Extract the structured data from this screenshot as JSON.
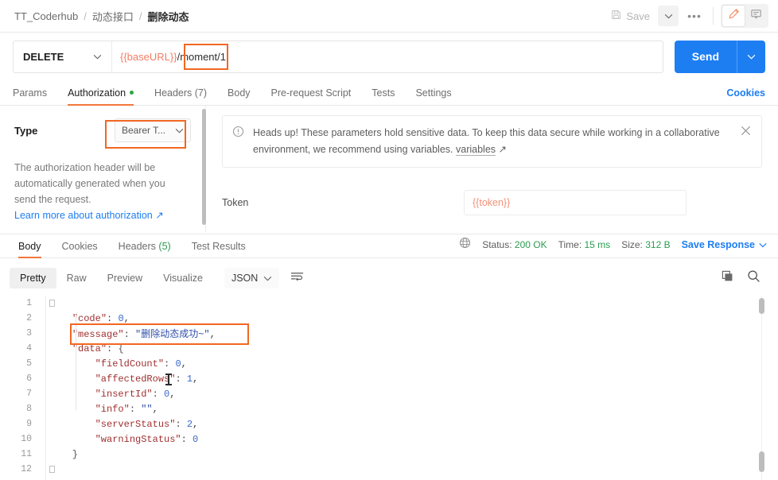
{
  "breadcrumb": {
    "items": [
      "TT_Coderhub",
      "动态接口",
      "删除动态"
    ],
    "separator": "/"
  },
  "topbar": {
    "save_label": "Save",
    "save_caret": "⌄",
    "more_label": "•••",
    "edit_icon": "pencil-icon",
    "comment_icon": "comment-icon"
  },
  "request": {
    "method": "DELETE",
    "method_caret": "⌄",
    "url_variable": "{{baseURL}}",
    "url_path": "/moment/1",
    "send_label": "Send",
    "send_caret": "⌄"
  },
  "request_tabs": [
    {
      "label": "Params",
      "selected": false,
      "dot": false
    },
    {
      "label": "Authorization",
      "selected": true,
      "dot": true
    },
    {
      "label": "Headers (7)",
      "selected": false,
      "dot": false
    },
    {
      "label": "Body",
      "selected": false,
      "dot": false
    },
    {
      "label": "Pre-request Script",
      "selected": false,
      "dot": false
    },
    {
      "label": "Tests",
      "selected": false,
      "dot": false
    },
    {
      "label": "Settings",
      "selected": false,
      "dot": false
    }
  ],
  "cookies_link": "Cookies",
  "auth": {
    "type_label": "Type",
    "type_value": "Bearer T...",
    "type_caret": "⌄",
    "description": "The authorization header will be automatically generated when you send the request.",
    "learn_more": "Learn more about authorization ↗",
    "alert_icon": "info-circle-icon",
    "alert_text": "Heads up! These parameters hold sensitive data. To keep this data secure while working in a collaborative environment, we recommend using variables.",
    "alert_link": "variables",
    "alert_link_arrow": "↗",
    "alert_close": "✕",
    "token_label": "Token",
    "token_value": "{{token}}"
  },
  "response_tabs": [
    {
      "label": "Body",
      "selected": true
    },
    {
      "label": "Cookies",
      "selected": false
    },
    {
      "label": "Headers",
      "count": "(5)",
      "selected": false
    },
    {
      "label": "Test Results",
      "selected": false
    }
  ],
  "response_meta": {
    "globe_icon": "globe-icon",
    "status_label": "Status:",
    "status_value": "200 OK",
    "time_label": "Time:",
    "time_value": "15 ms",
    "size_label": "Size:",
    "size_value": "312 B",
    "save_response": "Save Response",
    "save_response_caret": "⌄"
  },
  "body_toolbar": {
    "views": [
      {
        "label": "Pretty",
        "selected": true
      },
      {
        "label": "Raw",
        "selected": false
      },
      {
        "label": "Preview",
        "selected": false
      },
      {
        "label": "Visualize",
        "selected": false
      }
    ],
    "format": "JSON",
    "format_caret": "⌄",
    "wrap_icon": "word-wrap-icon",
    "copy_icon": "copy-icon",
    "search_icon": "search-icon"
  },
  "response_body": {
    "lines": [
      {
        "n": "1",
        "text": "{"
      },
      {
        "n": "2",
        "text": "    \"code\": 0,"
      },
      {
        "n": "3",
        "text": "    \"message\": \"删除动态成功~\","
      },
      {
        "n": "4",
        "text": "    \"data\": {"
      },
      {
        "n": "5",
        "text": "        \"fieldCount\": 0,"
      },
      {
        "n": "6",
        "text": "        \"affectedRows\": 1,"
      },
      {
        "n": "7",
        "text": "        \"insertId\": 0,"
      },
      {
        "n": "8",
        "text": "        \"info\": \"\","
      },
      {
        "n": "9",
        "text": "        \"serverStatus\": 2,"
      },
      {
        "n": "10",
        "text": "        \"warningStatus\": 0"
      },
      {
        "n": "11",
        "text": "    }"
      },
      {
        "n": "12",
        "text": "}"
      }
    ],
    "json": {
      "code": 0,
      "message": "删除动态成功~",
      "data": {
        "fieldCount": 0,
        "affectedRows": 1,
        "insertId": 0,
        "info": "",
        "serverStatus": 2,
        "warningStatus": 0
      }
    }
  },
  "colors": {
    "accent_orange": "#f26722",
    "send_blue": "#1d7ef2",
    "link_blue": "#1d7ef2",
    "status_green": "#2a9d50",
    "variable_red": "#f27d62",
    "json_key": "#a03030",
    "json_value": "#3a68c9"
  },
  "annotations": [
    {
      "name": "url-path-highlight"
    },
    {
      "name": "auth-type-highlight"
    },
    {
      "name": "message-line-highlight"
    }
  ]
}
